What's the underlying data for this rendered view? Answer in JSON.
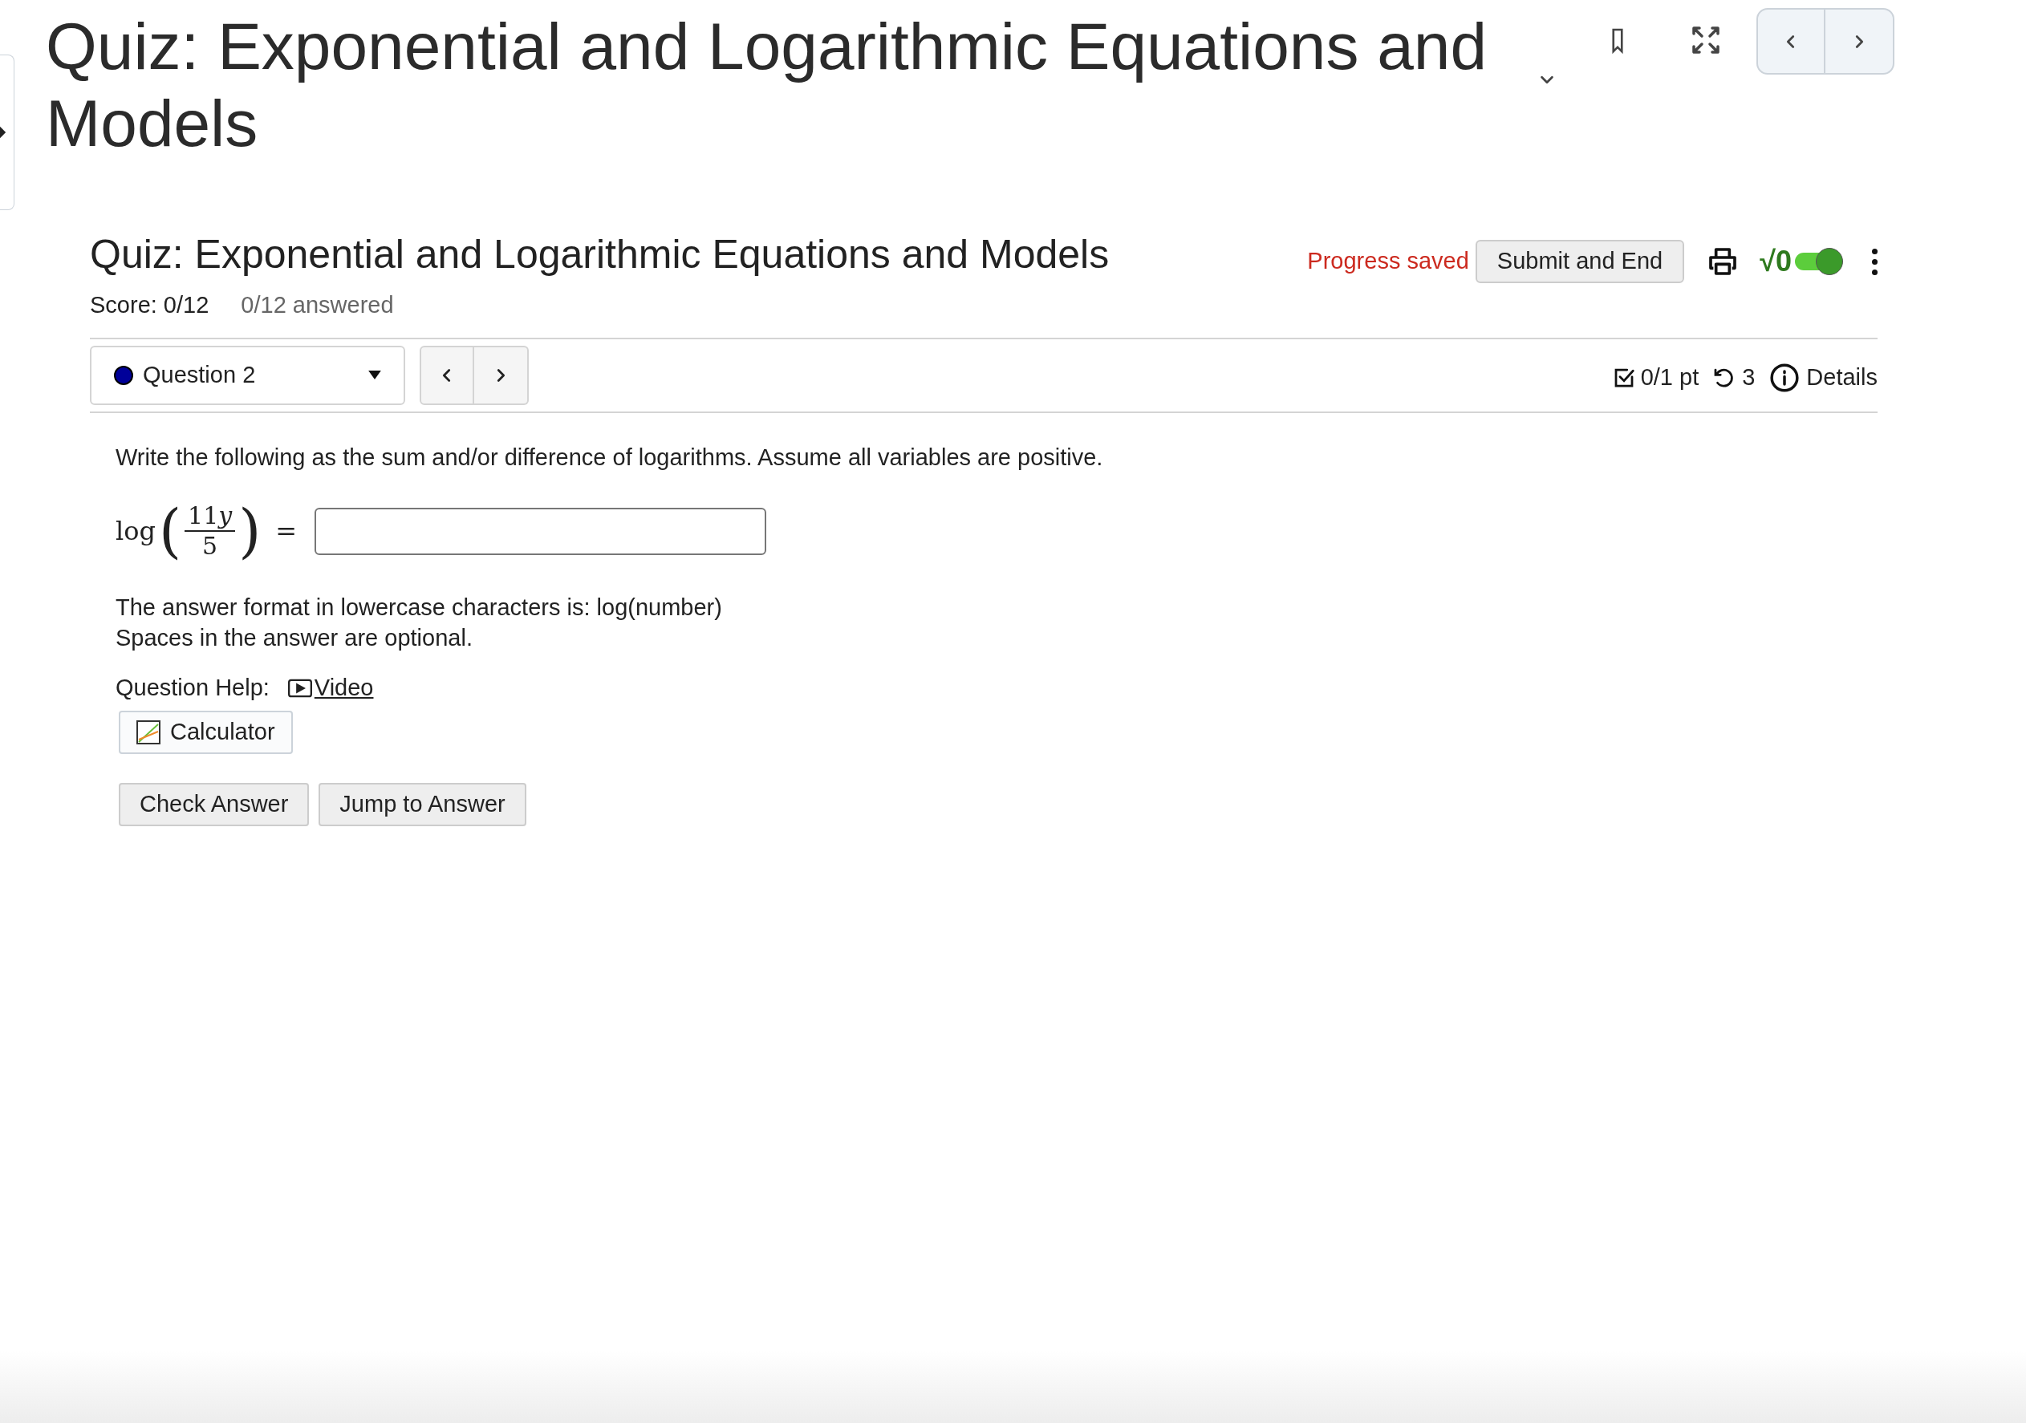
{
  "page_title": "Quiz: Exponential and Logarithmic Equations and Models",
  "quiz": {
    "title": "Quiz: Exponential and Logarithmic Equations and Models",
    "score": "Score: 0/12",
    "answered": "0/12 answered",
    "status": "Progress saved",
    "submit": "Submit and End",
    "math_toggle": {
      "label": "√0",
      "on": true
    }
  },
  "question_nav": {
    "label": "Question 2",
    "color": "#000099"
  },
  "meta": {
    "points": "0/1 pt",
    "attempts": "3",
    "details": "Details"
  },
  "question": {
    "prompt": "Write the following as the sum and/or difference of logarithms. Assume all variables are positive.",
    "expression": {
      "function": "log",
      "open": "(",
      "coefficient": "11",
      "variable": "y",
      "denominator": "5",
      "close": ")",
      "relation": "="
    },
    "notes": [
      "The answer format in lowercase characters is: log(number)",
      "Spaces in the answer are optional."
    ],
    "help_label": "Question Help:",
    "help_link": "Video",
    "calculator": "Calculator"
  },
  "buttons": [
    "Check Answer",
    "Jump to Answer"
  ]
}
